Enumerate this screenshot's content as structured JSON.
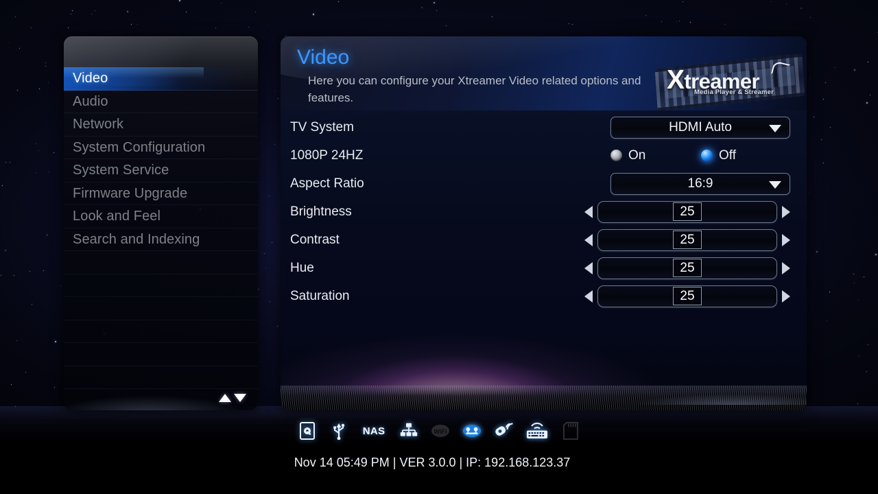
{
  "sidebar": {
    "items": [
      {
        "label": "Video",
        "selected": true
      },
      {
        "label": "Audio",
        "selected": false
      },
      {
        "label": "Network",
        "selected": false
      },
      {
        "label": "System Configuration",
        "selected": false
      },
      {
        "label": "System Service",
        "selected": false
      },
      {
        "label": "Firmware Upgrade",
        "selected": false
      },
      {
        "label": "Look and Feel",
        "selected": false
      },
      {
        "label": "Search and Indexing",
        "selected": false
      }
    ],
    "scroll_up_icon": "triangle-up-icon",
    "scroll_down_icon": "triangle-down-icon"
  },
  "header": {
    "title": "Video",
    "description": "Here you can configure your Xtreamer Video related options and features.",
    "logo_name": "Xtreamer",
    "logo_x": "X",
    "logo_rest": "treamer",
    "logo_tagline": "Media Player & Streamer"
  },
  "settings": {
    "tv_system": {
      "label": "TV System",
      "value": "HDMI Auto",
      "control": "dropdown",
      "caret_icon": "chevron-down-icon"
    },
    "p1080_24hz": {
      "label": "1080P 24HZ",
      "control": "radio-group",
      "options": [
        {
          "label": "On",
          "selected": false
        },
        {
          "label": "Off",
          "selected": true
        }
      ]
    },
    "aspect_ratio": {
      "label": "Aspect Ratio",
      "value": "16:9",
      "control": "dropdown",
      "caret_icon": "chevron-down-icon"
    },
    "brightness": {
      "label": "Brightness",
      "value": "25",
      "control": "slider"
    },
    "contrast": {
      "label": "Contrast",
      "value": "25",
      "control": "slider"
    },
    "hue": {
      "label": "Hue",
      "value": "25",
      "control": "slider"
    },
    "saturation": {
      "label": "Saturation",
      "value": "25",
      "control": "slider"
    },
    "slider_left_icon": "triangle-left-icon",
    "slider_right_icon": "triangle-right-icon"
  },
  "statusbar": {
    "icons": [
      {
        "name": "hdd-icon",
        "active": true
      },
      {
        "name": "usb-icon",
        "active": true
      },
      {
        "name": "nas-icon",
        "active": true,
        "text": "NAS"
      },
      {
        "name": "lan-network-icon",
        "active": true
      },
      {
        "name": "wifi-icon",
        "active": false
      },
      {
        "name": "esata-icon",
        "active": true
      },
      {
        "name": "wireless-remote-icon",
        "active": true
      },
      {
        "name": "wireless-keyboard-icon",
        "active": true
      },
      {
        "name": "sd-card-icon",
        "active": false
      }
    ],
    "status_text": "Nov 14 05:49 PM | VER 3.0.0 | IP: 192.168.123.37"
  },
  "colors": {
    "accent_blue": "#3d97ff",
    "selected_menu": "#1256be",
    "text_primary": "#e8ebf0",
    "text_muted": "#7d8188",
    "radio_on": "#0f6ede"
  }
}
